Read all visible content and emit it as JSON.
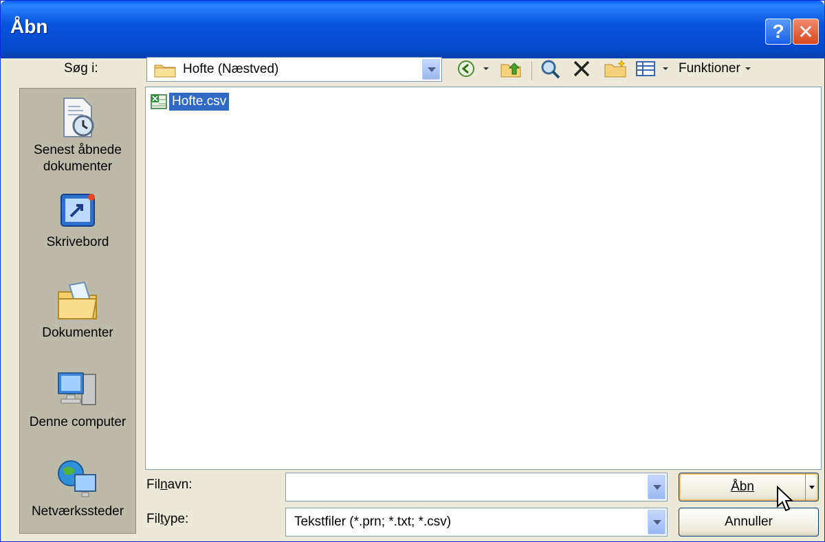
{
  "window": {
    "title": "Åbn"
  },
  "lookin": {
    "label": "Søg i:",
    "value": "Hofte (Næstved)"
  },
  "toolbar": {
    "tools_label": "Funktioner"
  },
  "places": [
    {
      "label": "Senest åbnede dokumenter",
      "icon": "recent-documents-icon"
    },
    {
      "label": "Skrivebord",
      "icon": "desktop-icon"
    },
    {
      "label": "Dokumenter",
      "icon": "documents-icon"
    },
    {
      "label": "Denne computer",
      "icon": "computer-icon"
    },
    {
      "label": "Netværkssteder",
      "icon": "network-icon"
    }
  ],
  "files": [
    {
      "name": "Hofte.csv",
      "icon": "excel-csv-icon"
    }
  ],
  "filename": {
    "label": "Filnavn:",
    "value": ""
  },
  "filetype": {
    "label": "Filtype:",
    "value": "Tekstfiler (*.prn; *.txt; *.csv)"
  },
  "buttons": {
    "open": "Åbn",
    "cancel": "Annuller"
  },
  "colors": {
    "title_bar": "#0855dd",
    "selection": "#316ac5",
    "dialog_bg": "#ece9d8"
  }
}
